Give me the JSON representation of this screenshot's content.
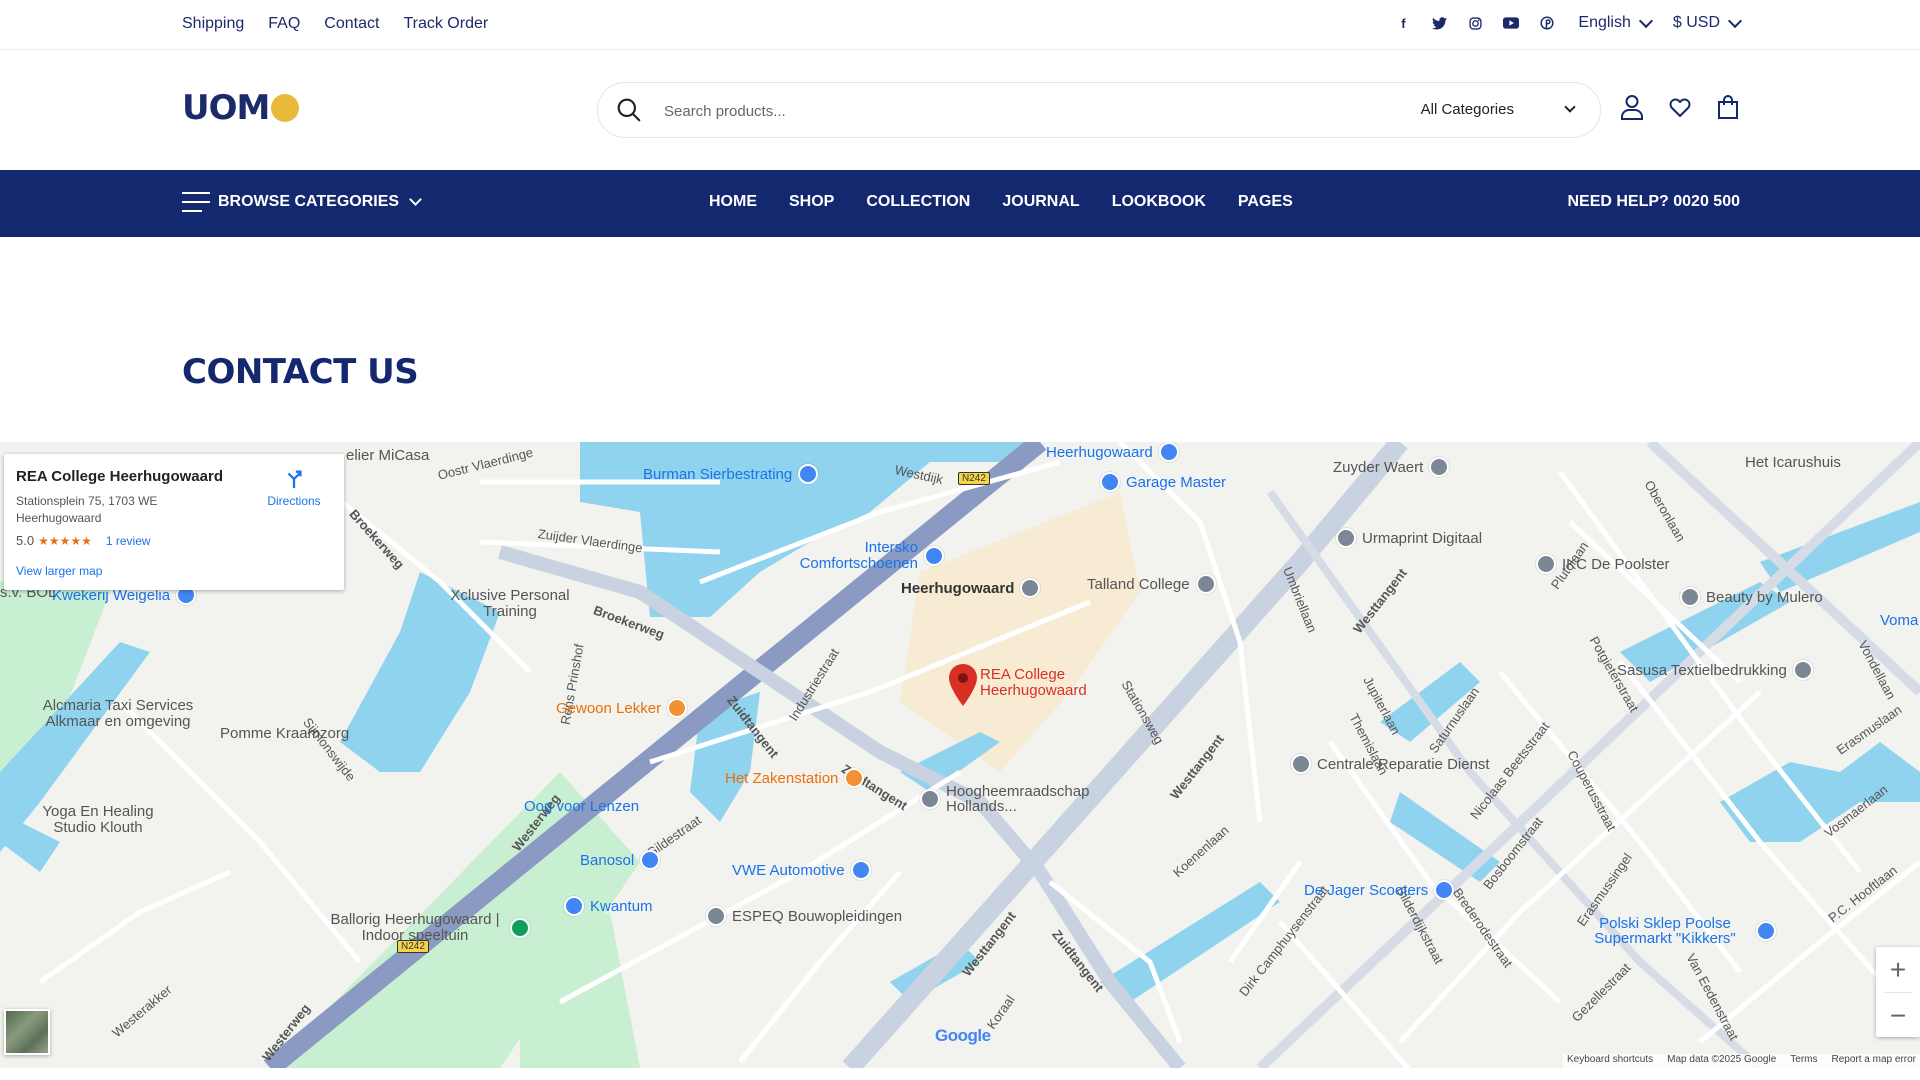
{
  "topbar": {
    "links": [
      "Shipping",
      "FAQ",
      "Contact",
      "Track Order"
    ],
    "social": [
      "facebook-icon",
      "twitter-icon",
      "instagram-icon",
      "youtube-icon",
      "pinterest-icon"
    ],
    "language": "English",
    "currency": "$ USD"
  },
  "header": {
    "logo_text": "UOM",
    "search_placeholder": "Search products...",
    "category": "All Categories"
  },
  "nav": {
    "browse": "BROWSE CATEGORIES",
    "menu": [
      "HOME",
      "SHOP",
      "COLLECTION",
      "JOURNAL",
      "LOOKBOOK",
      "PAGES"
    ],
    "help": "NEED HELP? 0020 500"
  },
  "page_title": "CONTACT US",
  "map": {
    "card": {
      "name": "REA College Heerhugowaard",
      "address": "Stationsplein 75, 1703 WE Heerhugowaard",
      "rating": "5.0",
      "stars": "★★★★★",
      "reviews": "1 review",
      "directions": "Directions",
      "larger_map": "View larger map"
    },
    "marker_label": "REA College Heerhugowaard",
    "places": [
      "Heerhugowaard",
      "Garage Master",
      "Burman Sierbestrating",
      "Zuyder Waert",
      "Het Icarushuis",
      "Urmaprint Digitaal",
      "IKC De Poolster",
      "Intersko Comfortschoenen",
      "Heerhugowaard",
      "Talland College",
      "Beauty by Mulero",
      "Kwekerij Weigelia",
      "Xclusive Personal Training",
      "Sasusa Textielbedrukking",
      "Alcmaria Taxi Services Alkmaar en omgeving",
      "Pomme Kraamzorg",
      "Gewoon Lekker",
      "Centrale Reparatie Dienst",
      "Het Zakenstation",
      "Oog voor Lenzen",
      "Hoogheemraadschap Hollands...",
      "Yoga En Healing Studio Klouth",
      "Banosol",
      "VWE Automotive",
      "De Jager Scooters",
      "Kwantum",
      "ESPEQ Bouwopleidingen",
      "Ballorig Heerhugowaard | Indoor speeltuin",
      "Polski Sklep Poolse Supermarkt \"Kikkers\"",
      "elier MiCasa",
      "s.v. BOL",
      "Voma"
    ],
    "streets": [
      "Oostr Vlaerdinge",
      "Westdijk",
      "Broekerweg",
      "Zuijder Vlaerdinge",
      "Broekerweg",
      "Industriestraat",
      "Zuidtangent",
      "Zuidtangent",
      "Westerweg",
      "Stationsweg",
      "Umbriellaan",
      "Westtangent",
      "Jupiterlaan",
      "Saturnuslaan",
      "Westtangent",
      "Plutolaan",
      "Potgieterstraat",
      "Nicolaas Beetsstraat",
      "Couperusstraat",
      "Bosboomstraat",
      "Erasmuslaan",
      "Vondellaan",
      "Vosmaerlaan",
      "P.C. Hooftlaan",
      "Koenenlaan",
      "Dirk Camphuysenstraat",
      "Bilderdijkstraat",
      "Brederodestraat",
      "Erasmussingel",
      "Gezellestraat",
      "Van Eedenstraat",
      "Westtangent",
      "Zuidtangent",
      "Koraal",
      "Gildestraat",
      "Rens Prinshof",
      "Sijmonswijde",
      "Westerakker",
      "Themislaan",
      "Oberonlaan",
      "Westerweg",
      "N242",
      "N242"
    ],
    "google": "Google",
    "attribution": [
      "Keyboard shortcuts",
      "Map data ©2025 Google",
      "Terms",
      "Report a map error"
    ],
    "zoom_in": "+",
    "zoom_out": "−"
  },
  "colors": {
    "brand_navy": "#14286f",
    "logo_accent": "#e8b93a",
    "water": "#8fd3ef",
    "park": "#c9efd2",
    "marker": "#d93025"
  }
}
